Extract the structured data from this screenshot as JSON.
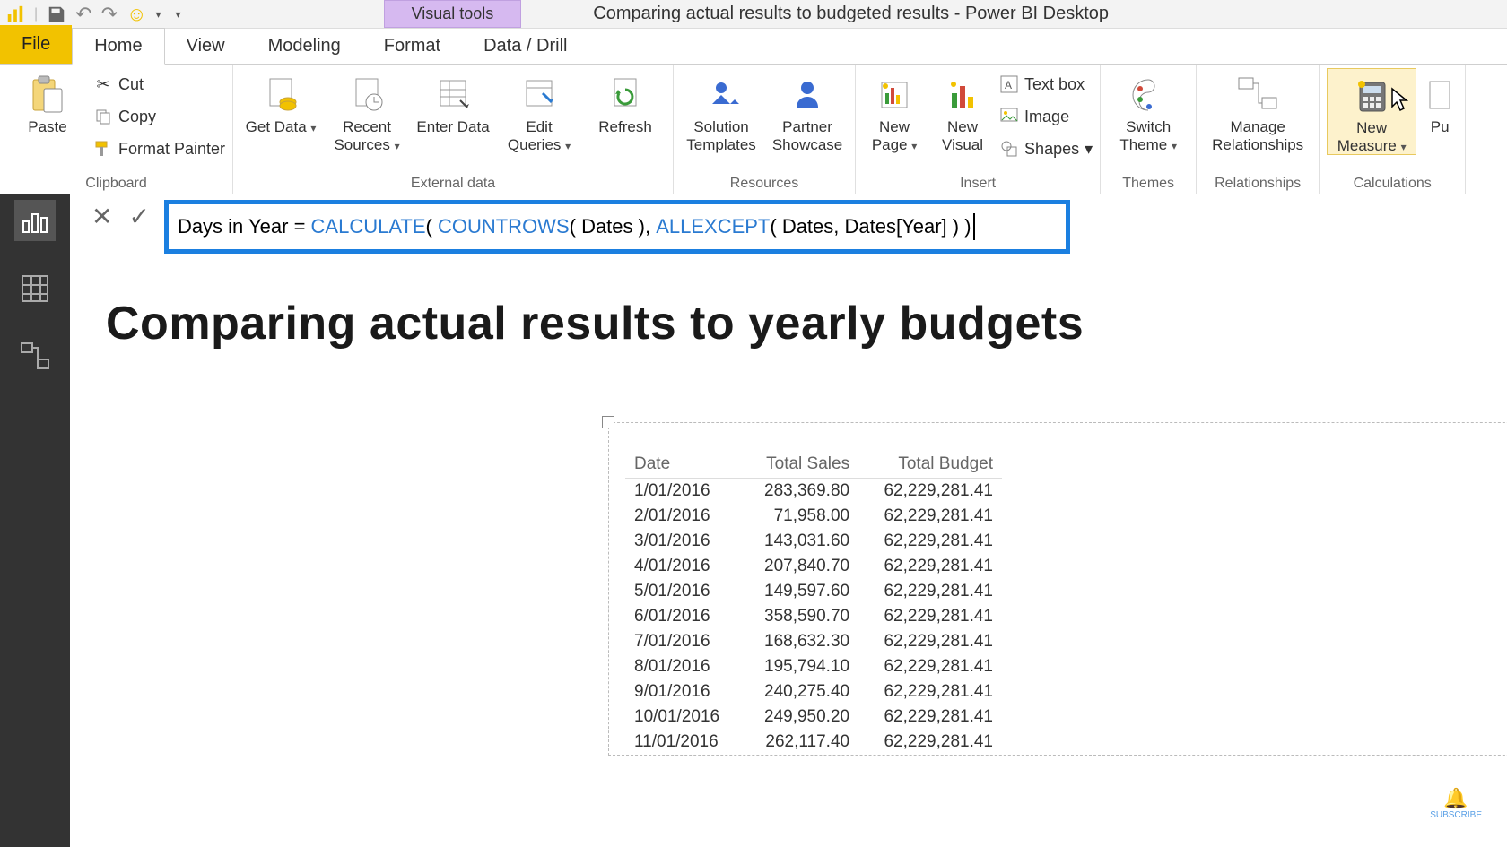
{
  "titlebar": {
    "doc_title": "Comparing actual results to budgeted results - Power BI Desktop",
    "visual_tools": "Visual tools"
  },
  "tabs": {
    "file": "File",
    "home": "Home",
    "view": "View",
    "modeling": "Modeling",
    "format": "Format",
    "data_drill": "Data / Drill"
  },
  "ribbon": {
    "clipboard": {
      "group": "Clipboard",
      "paste": "Paste",
      "cut": "Cut",
      "copy": "Copy",
      "format_painter": "Format Painter"
    },
    "external": {
      "group": "External data",
      "get_data": "Get Data",
      "recent_sources": "Recent Sources",
      "enter_data": "Enter Data",
      "edit_queries": "Edit Queries",
      "refresh": "Refresh"
    },
    "resources": {
      "group": "Resources",
      "solution_templates": "Solution Templates",
      "partner_showcase": "Partner Showcase"
    },
    "insert": {
      "group": "Insert",
      "new_page": "New Page",
      "new_visual": "New Visual",
      "text_box": "Text box",
      "image": "Image",
      "shapes": "Shapes"
    },
    "themes": {
      "group": "Themes",
      "switch_theme": "Switch Theme"
    },
    "relationships": {
      "group": "Relationships",
      "manage": "Manage Relationships"
    },
    "calculations": {
      "group": "Calculations",
      "new_measure": "New Measure",
      "pu": "Pu"
    }
  },
  "formula": {
    "prefix": "Days in Year = ",
    "calc": "CALCULATE",
    "p1": "( ",
    "countrows": "COUNTROWS",
    "p2": "( Dates ), ",
    "allexcept": "ALLEXCEPT",
    "p3": "( Dates, Dates[Year] ) )"
  },
  "report": {
    "title": "Comparing actual results to yearly budgets"
  },
  "table": {
    "headers": {
      "date": "Date",
      "sales": "Total Sales",
      "budget": "Total Budget"
    },
    "rows": [
      {
        "date": "1/01/2016",
        "sales": "283,369.80",
        "budget": "62,229,281.41"
      },
      {
        "date": "2/01/2016",
        "sales": "71,958.00",
        "budget": "62,229,281.41"
      },
      {
        "date": "3/01/2016",
        "sales": "143,031.60",
        "budget": "62,229,281.41"
      },
      {
        "date": "4/01/2016",
        "sales": "207,840.70",
        "budget": "62,229,281.41"
      },
      {
        "date": "5/01/2016",
        "sales": "149,597.60",
        "budget": "62,229,281.41"
      },
      {
        "date": "6/01/2016",
        "sales": "358,590.70",
        "budget": "62,229,281.41"
      },
      {
        "date": "7/01/2016",
        "sales": "168,632.30",
        "budget": "62,229,281.41"
      },
      {
        "date": "8/01/2016",
        "sales": "195,794.10",
        "budget": "62,229,281.41"
      },
      {
        "date": "9/01/2016",
        "sales": "240,275.40",
        "budget": "62,229,281.41"
      },
      {
        "date": "10/01/2016",
        "sales": "249,950.20",
        "budget": "62,229,281.41"
      },
      {
        "date": "11/01/2016",
        "sales": "262,117.40",
        "budget": "62,229,281.41"
      }
    ]
  },
  "subscribe": "SUBSCRIBE"
}
